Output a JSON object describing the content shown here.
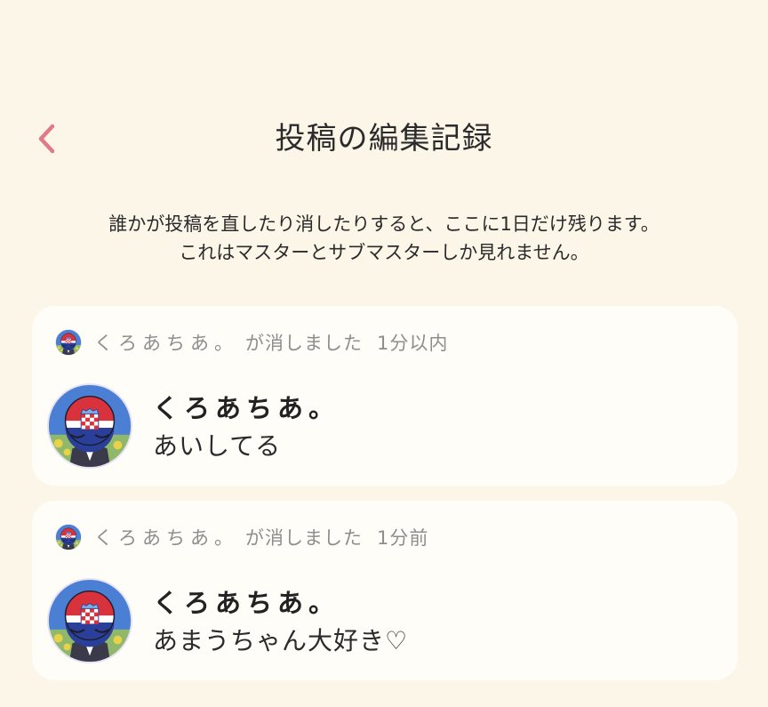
{
  "header": {
    "title": "投稿の編集記録",
    "back_icon": "chevron-left-icon",
    "accent_color": "#e07a86"
  },
  "notice": {
    "line1": "誰かが投稿を直したり消したりすると、ここに1日だけ残ります。",
    "line2": "これはマスターとサブマスターしか見れません。"
  },
  "records": [
    {
      "log_user": "くろあちあ。",
      "log_action": "が消しました",
      "log_time": "1分以内",
      "author": "くろあちあ。",
      "body": "あいしてる"
    },
    {
      "log_user": "くろあちあ。",
      "log_action": "が消しました",
      "log_time": "1分前",
      "author": "くろあちあ。",
      "body": "あまうちゃん大好き♡"
    }
  ]
}
